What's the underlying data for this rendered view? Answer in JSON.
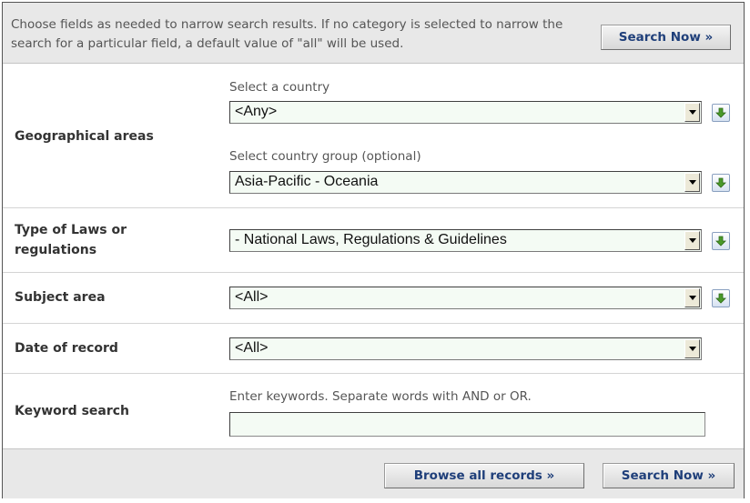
{
  "header": {
    "intro_text": "Choose fields as needed to narrow search results. If no category is selected to narrow the search for a particular field, a default value of \"all\" will be used.",
    "search_now_label": "Search Now »"
  },
  "rows": {
    "geographical": {
      "label": "Geographical areas",
      "country_hint": "Select a country",
      "country_value": "<Any>",
      "group_hint": "Select country group (optional)",
      "group_value": "Asia-Pacific - Oceania"
    },
    "laws": {
      "label_line1": "Type of Laws or",
      "label_line2": "regulations",
      "value": "- National Laws, Regulations & Guidelines"
    },
    "subject": {
      "label": "Subject area",
      "value": "<All>"
    },
    "date": {
      "label": "Date of record",
      "value": "<All>"
    },
    "keyword": {
      "label": "Keyword search",
      "hint": "Enter keywords. Separate words with AND or OR.",
      "value": ""
    }
  },
  "footer": {
    "browse_all_label": "Browse all records »",
    "search_now_label": "Search Now »"
  },
  "icons": {
    "add": "add-to-selection-icon",
    "dropdown": "chevron-down-icon"
  },
  "colors": {
    "button_text": "#1f3f7a",
    "select_background": "#f4fbf4",
    "add_arrow": "#4a9a2a",
    "header_background": "#e8e8e8"
  }
}
